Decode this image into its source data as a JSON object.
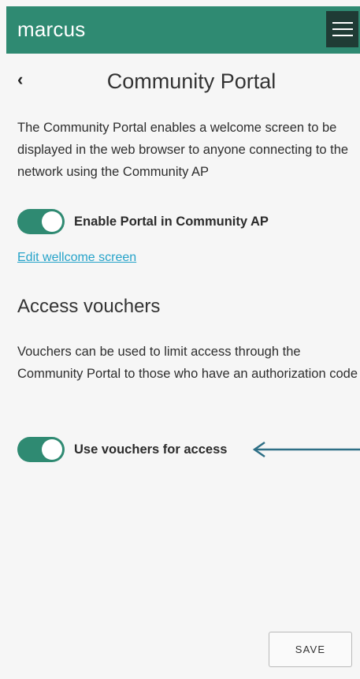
{
  "app": {
    "brand": "marcus"
  },
  "header": {
    "back_glyph": "‹",
    "title": "Community Portal"
  },
  "portal": {
    "description": "The Community Portal enables a welcome screen to be displayed in the web browser to anyone connecting to the network using the Community AP",
    "toggle_label": "Enable Portal in Community AP",
    "toggle_on": true,
    "edit_link": "Edit wellcome screen"
  },
  "vouchers": {
    "title": "Access vouchers",
    "description": "Vouchers can be used to limit access through the Community Portal to those who have an authorization code",
    "toggle_label": "Use vouchers for access",
    "toggle_on": true
  },
  "actions": {
    "save_label": "SAVE"
  },
  "colors": {
    "accent": "#2f8a72",
    "menu_bg": "#1f3b35",
    "link": "#26a3c9",
    "arrow": "#2e6f86"
  },
  "icons": {
    "menu": "hamburger-menu-icon",
    "back": "chevron-left-icon",
    "annotation": "arrow-left-icon"
  }
}
